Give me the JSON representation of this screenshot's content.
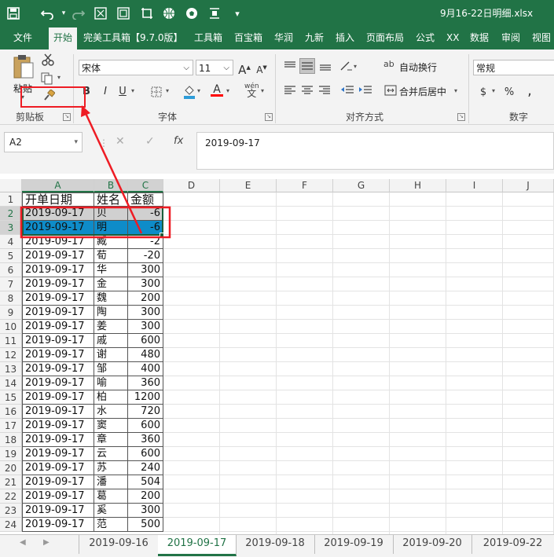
{
  "titlebar": {
    "save_icon": "save-icon",
    "undo_icon": "undo-icon",
    "redo_icon": "redo-icon",
    "window_title": "9月16-22日明细.xlsx"
  },
  "menu": {
    "tabs": [
      "文件",
      "开始",
      "完美工具箱【9.7.0版】",
      "工具箱",
      "百宝箱",
      "华润",
      "九新",
      "插入",
      "页面布局",
      "公式",
      "XX",
      "数据",
      "审阅",
      "视图"
    ],
    "active": "开始"
  },
  "ribbon": {
    "clipboard": {
      "paste_label": "粘贴",
      "group_label": "剪贴板"
    },
    "font": {
      "font_name": "宋体",
      "font_size": "11",
      "bold": "B",
      "italic": "I",
      "underline": "U",
      "group_label": "字体",
      "font_color": "#ff0000",
      "fill_color": "#2e9cd8"
    },
    "alignment": {
      "wrap_text": "自动换行",
      "merge_center": "合并后居中",
      "group_label": "对齐方式"
    },
    "number": {
      "format": "常规",
      "percent": "%",
      "comma": ",",
      "currency": "$",
      "group_label": "数字"
    }
  },
  "formula_bar": {
    "name_box": "A2",
    "fx": "fx",
    "value": "2019-09-17"
  },
  "sheet": {
    "columns": [
      "A",
      "B",
      "C",
      "D",
      "E",
      "F",
      "G",
      "H",
      "I",
      "J"
    ],
    "headers": [
      "开单日期",
      "姓名",
      "金额"
    ],
    "rows": [
      {
        "date": "2019-09-17",
        "name": "贝",
        "amount": "-6"
      },
      {
        "date": "2019-09-17",
        "name": "明",
        "amount": "-6"
      },
      {
        "date": "2019-09-17",
        "name": "臧",
        "amount": "-2"
      },
      {
        "date": "2019-09-17",
        "name": "荀",
        "amount": "-20"
      },
      {
        "date": "2019-09-17",
        "name": "华",
        "amount": "300"
      },
      {
        "date": "2019-09-17",
        "name": "金",
        "amount": "300"
      },
      {
        "date": "2019-09-17",
        "name": "魏",
        "amount": "200"
      },
      {
        "date": "2019-09-17",
        "name": "陶",
        "amount": "300"
      },
      {
        "date": "2019-09-17",
        "name": "姜",
        "amount": "300"
      },
      {
        "date": "2019-09-17",
        "name": "戚",
        "amount": "600"
      },
      {
        "date": "2019-09-17",
        "name": "谢",
        "amount": "480"
      },
      {
        "date": "2019-09-17",
        "name": "邹",
        "amount": "400"
      },
      {
        "date": "2019-09-17",
        "name": "喻",
        "amount": "360"
      },
      {
        "date": "2019-09-17",
        "name": "柏",
        "amount": "1200"
      },
      {
        "date": "2019-09-17",
        "name": "水",
        "amount": "720"
      },
      {
        "date": "2019-09-17",
        "name": "窦",
        "amount": "600"
      },
      {
        "date": "2019-09-17",
        "name": "章",
        "amount": "360"
      },
      {
        "date": "2019-09-17",
        "name": "云",
        "amount": "600"
      },
      {
        "date": "2019-09-17",
        "name": "苏",
        "amount": "240"
      },
      {
        "date": "2019-09-17",
        "name": "潘",
        "amount": "504"
      },
      {
        "date": "2019-09-17",
        "name": "葛",
        "amount": "200"
      },
      {
        "date": "2019-09-17",
        "name": "奚",
        "amount": "300"
      },
      {
        "date": "2019-09-17",
        "name": "范",
        "amount": "500"
      }
    ]
  },
  "sheet_tabs": [
    "2019-09-16",
    "2019-09-17",
    "2019-09-18",
    "2019-09-19",
    "2019-09-20",
    "2019-09-22"
  ],
  "active_sheet": "2019-09-17",
  "colors": {
    "brand": "#217346",
    "selection": "#0e8cc9",
    "annotation": "#ee1c24"
  }
}
